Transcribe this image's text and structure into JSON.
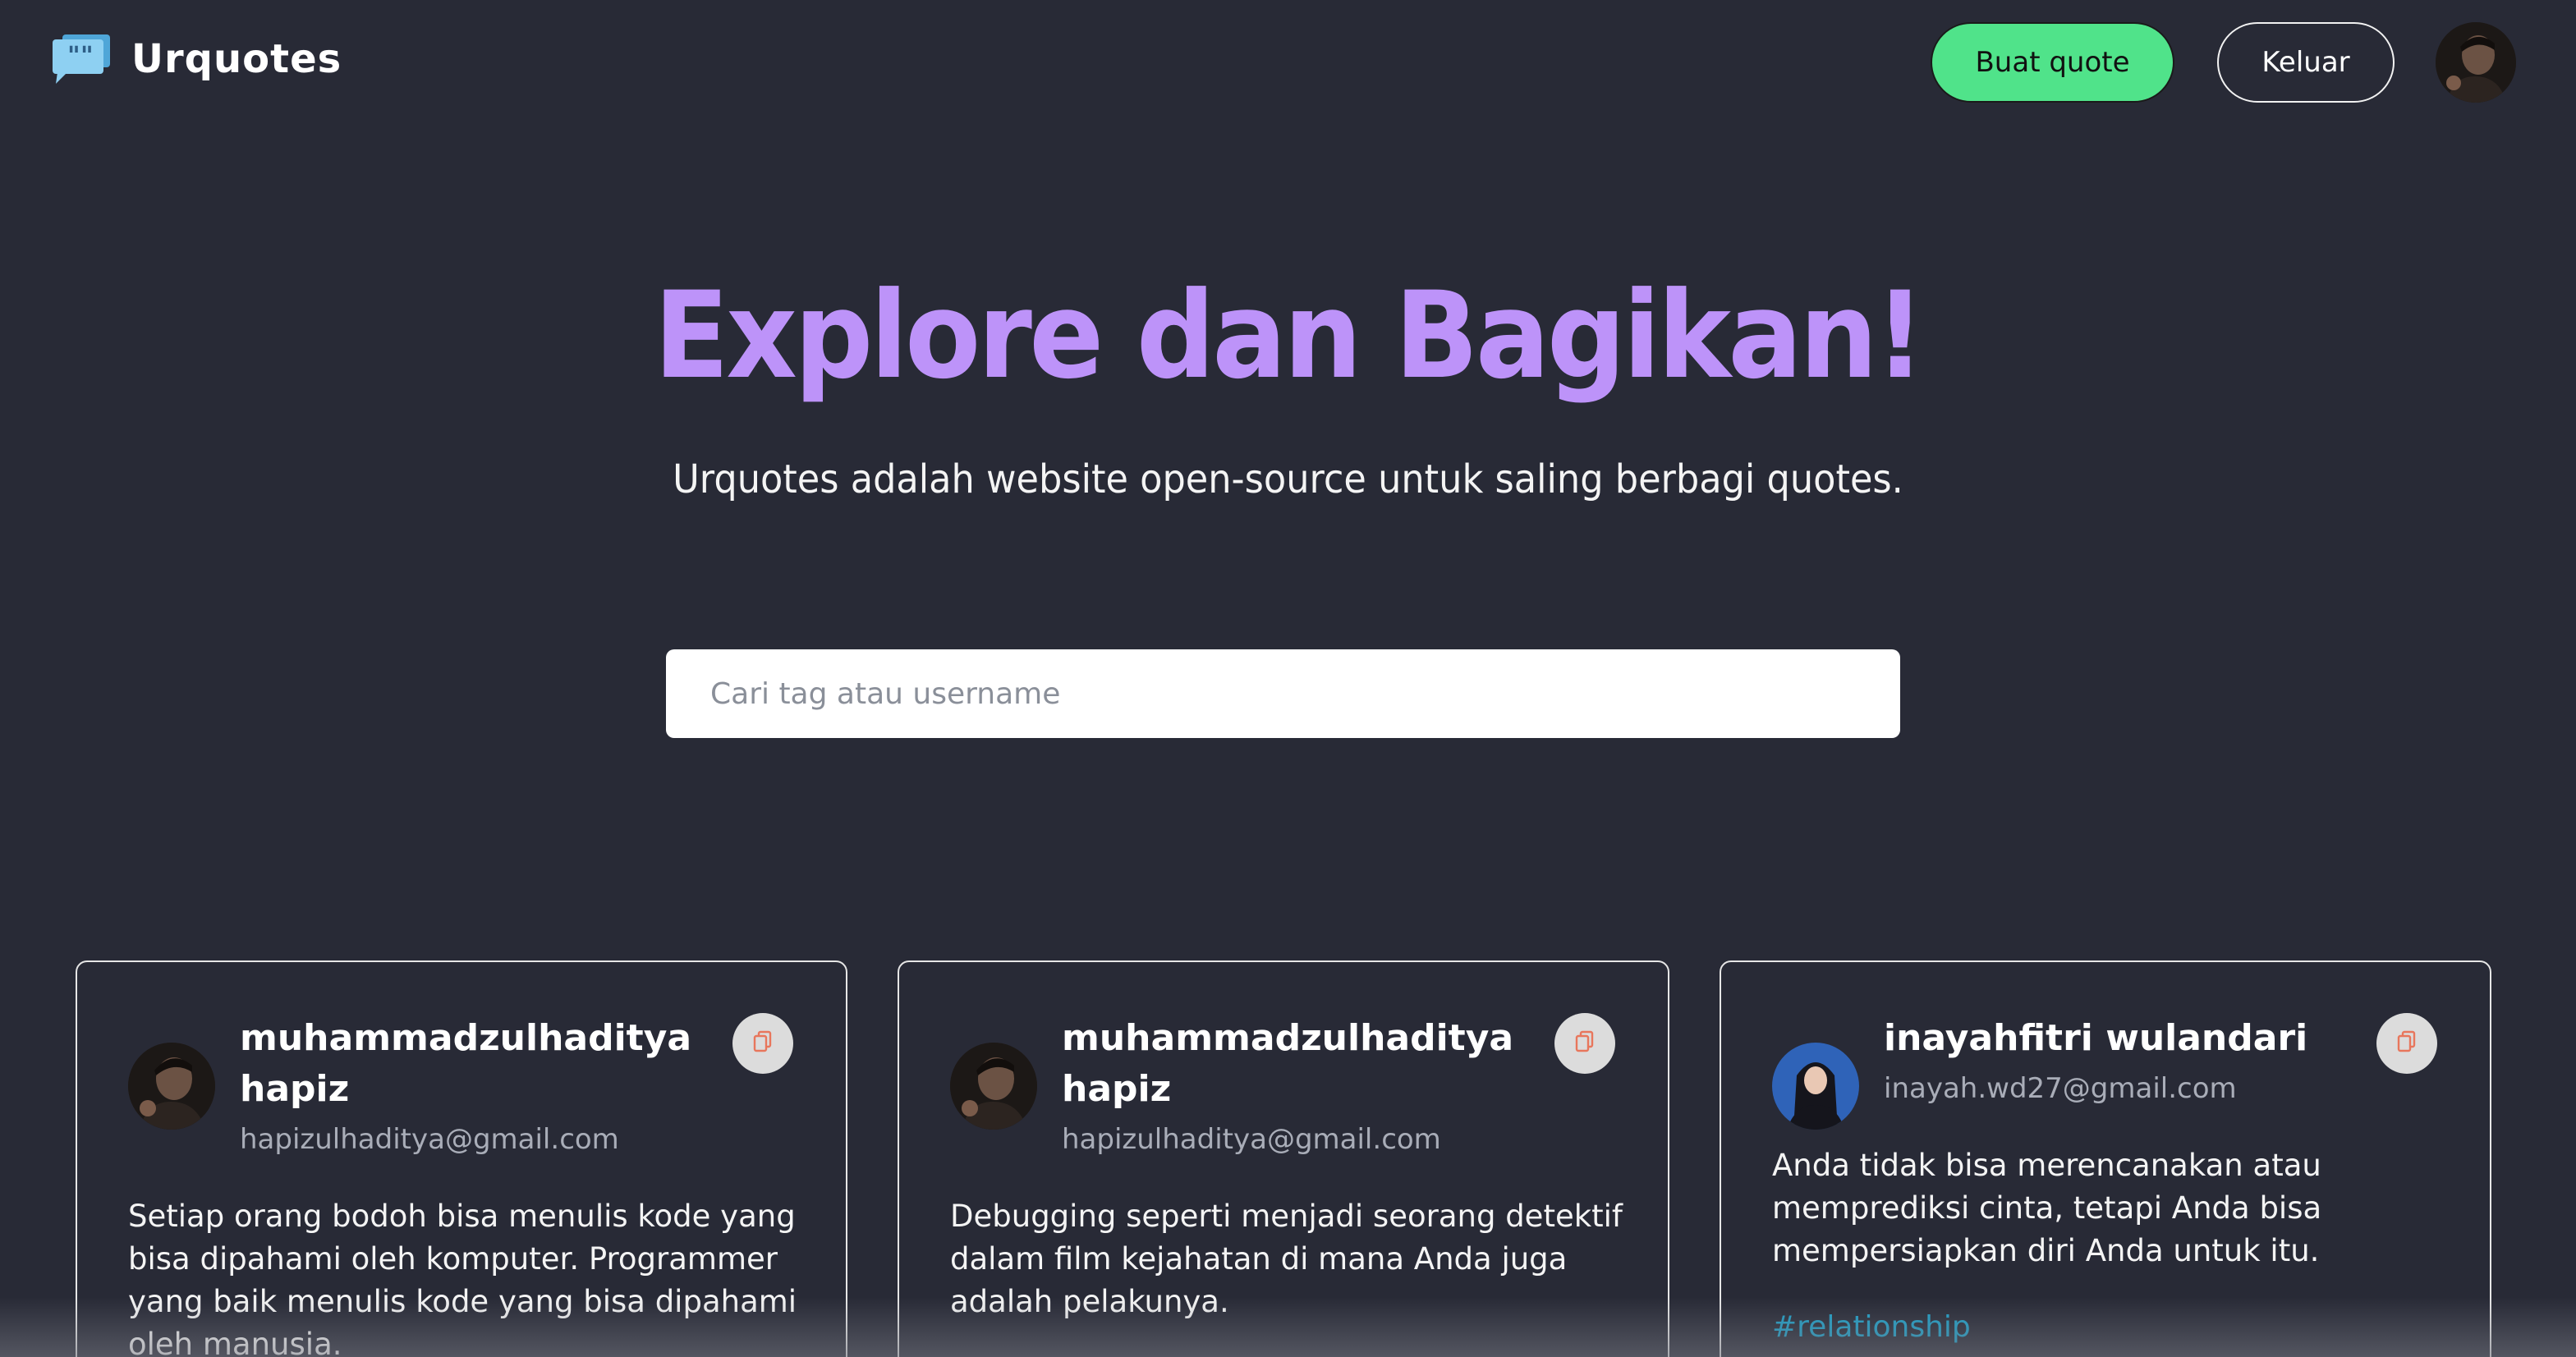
{
  "header": {
    "app_name": "Urquotes",
    "create_button": "Buat quote",
    "logout_button": "Keluar"
  },
  "hero": {
    "title": "Explore dan Bagikan!",
    "subtitle": "Urquotes adalah website open-source untuk saling berbagi quotes."
  },
  "search": {
    "placeholder": "Cari tag atau username",
    "value": ""
  },
  "cards": [
    {
      "name": "muhammadzulhaditya hapiz",
      "email": "hapizulhaditya@gmail.com",
      "quote": "Setiap orang bodoh bisa menulis kode yang bisa dipahami oleh komputer. Programmer yang baik menulis kode yang bisa dipahami oleh manusia.",
      "tag": ""
    },
    {
      "name": "muhammadzulhaditya hapiz",
      "email": "hapizulhaditya@gmail.com",
      "quote": "Debugging seperti menjadi seorang detektif dalam film kejahatan di mana Anda juga adalah pelakunya.",
      "tag": ""
    },
    {
      "name": "inayahfitri wulandari",
      "email": "inayah.wd27@gmail.com",
      "quote": "Anda tidak bisa merencanakan atau memprediksi cinta, tetapi Anda bisa mempersiapkan diri Anda untuk itu.",
      "tag": "#relationship"
    }
  ],
  "icons": {
    "logo": "quote-bubble-icon",
    "copy": "copy-icon"
  },
  "colors": {
    "background": "#282a36",
    "accent_purple": "#bd93f9",
    "create_button": "#50e38a",
    "tag": "#1ea0c8",
    "copy_icon": "#e8765c"
  }
}
